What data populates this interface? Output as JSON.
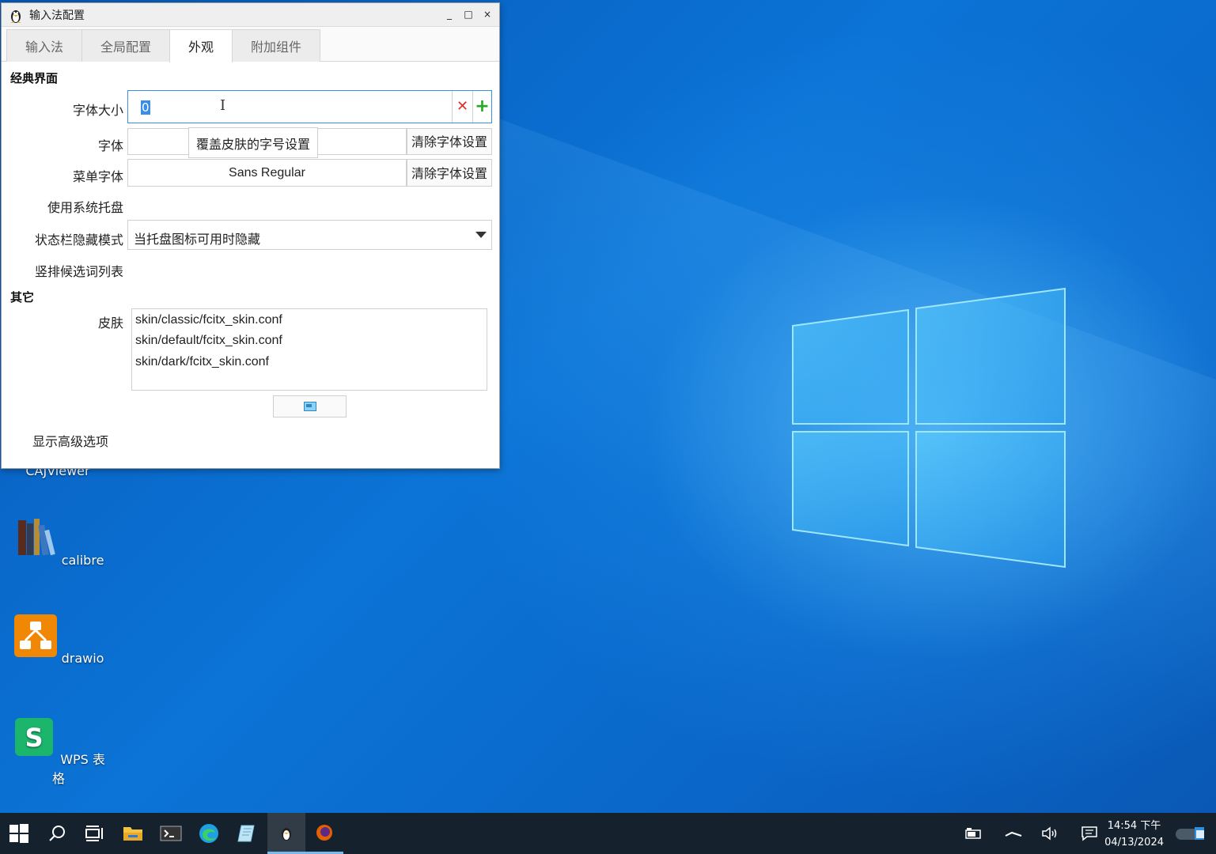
{
  "window": {
    "title": "输入法配置",
    "minimize": "_",
    "maximize": "□",
    "close": "×"
  },
  "tabs": [
    {
      "label": "输入法"
    },
    {
      "label": "全局配置"
    },
    {
      "label": "外观"
    },
    {
      "label": "附加组件"
    }
  ],
  "classic": {
    "section": "经典界面",
    "font_size_label": "字体大小",
    "font_size_value": "0",
    "font_label": "字体",
    "font_value": "",
    "tooltip": "覆盖皮肤的字号设置",
    "clear_font": "清除字体设置",
    "menu_font_label": "菜单字体",
    "menu_font_value": "Sans Regular",
    "clear_menu_font": "清除字体设置",
    "tray_label": "使用系统托盘",
    "statusbar_label": "状态栏隐藏模式",
    "statusbar_value": "当托盘图标可用时隐藏",
    "vertical_label": "竖排候选词列表"
  },
  "other": {
    "section": "其它",
    "skin_label": "皮肤",
    "skins": [
      "skin/classic/fcitx_skin.conf",
      "skin/default/fcitx_skin.conf",
      "skin/dark/fcitx_skin.conf"
    ],
    "advanced": "显示高级选项"
  },
  "desktop_icons": [
    {
      "label": "CAJViewer"
    },
    {
      "label": "calibre"
    },
    {
      "label": "drawio"
    },
    {
      "label": "WPS 表格"
    }
  ],
  "taskbar": {
    "time": "14:54 下午",
    "date": "04/13/2024"
  },
  "colors": {
    "accent": "#3a8ee6",
    "taskbar": "#15222e",
    "desktop": "#0a6fd3",
    "drawio": "#f08705",
    "wps": "#1bb56c"
  }
}
